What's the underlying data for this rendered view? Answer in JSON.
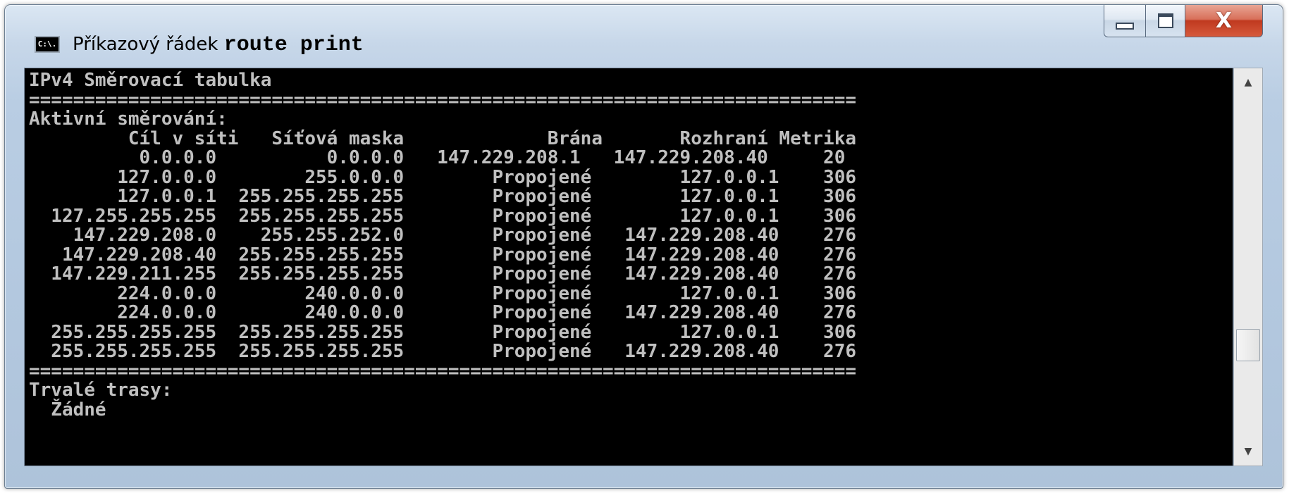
{
  "window": {
    "title": "Příkazový řádek",
    "command": "route print",
    "icon": "console-icon",
    "icon_text": "C:\\."
  },
  "caption_buttons": {
    "minimize": "minimize-icon",
    "maximize": "maximize-icon",
    "close": "X"
  },
  "console": {
    "lines": [
      "IPv4 Směrovací tabulka",
      "===========================================================================",
      "Aktivní směrování:",
      "         Cíl v síti   Síťová maska             Brána       Rozhraní Metrika",
      "          0.0.0.0          0.0.0.0   147.229.208.1   147.229.208.40     20",
      "        127.0.0.0        255.0.0.0        Propojené        127.0.0.1    306",
      "        127.0.0.1  255.255.255.255        Propojené        127.0.0.1    306",
      "  127.255.255.255  255.255.255.255        Propojené        127.0.0.1    306",
      "    147.229.208.0    255.255.252.0        Propojené   147.229.208.40    276",
      "   147.229.208.40  255.255.255.255        Propojené   147.229.208.40    276",
      "  147.229.211.255  255.255.255.255        Propojené   147.229.208.40    276",
      "        224.0.0.0        240.0.0.0        Propojené        127.0.0.1    306",
      "        224.0.0.0        240.0.0.0        Propojené   147.229.208.40    276",
      "  255.255.255.255  255.255.255.255        Propojené        127.0.0.1    306",
      "  255.255.255.255  255.255.255.255        Propojené   147.229.208.40    276",
      "===========================================================================",
      "Trvalé trasy:",
      "  Žádné"
    ]
  },
  "scrollbar": {
    "up_arrow": "▲",
    "down_arrow": "▼",
    "position": 0.75
  }
}
